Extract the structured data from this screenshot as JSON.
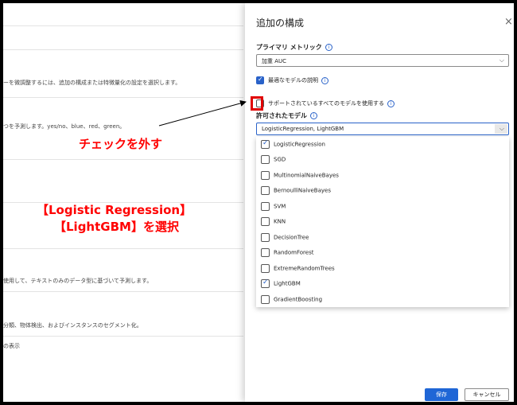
{
  "background": {
    "texts": [
      "ーを微調整するには、追加の構成または特徴量化の設定を選択します。",
      "つを予測します。yes/no、blue、red、green。",
      "使用して、テキストのみのデータ型に基づいて予測します。",
      "分類、物体検出、およびインスタンスのセグメント化。",
      "の表示"
    ]
  },
  "annotations": {
    "uncheck": "チェックを外す",
    "select_line1": "【Logistic Regression】",
    "select_line2": "【LightGBM】を選択"
  },
  "panel": {
    "title": "追加の構成",
    "close": "×",
    "primary_metric_label": "プライマリ メトリック",
    "primary_metric_value": "加重 AUC",
    "explain_best_model": "最適なモデルの説明",
    "explain_best_model_checked": true,
    "use_all_models": "サポートされているすべてのモデルを使用する",
    "use_all_models_checked": false,
    "allowed_models_label": "許可されたモデル",
    "allowed_models_value": "LogisticRegression, LightGBM",
    "models": [
      {
        "name": "LogisticRegression",
        "checked": true
      },
      {
        "name": "SGD",
        "checked": false
      },
      {
        "name": "MultinomialNaiveBayes",
        "checked": false
      },
      {
        "name": "BernoulliNaiveBayes",
        "checked": false
      },
      {
        "name": "SVM",
        "checked": false
      },
      {
        "name": "KNN",
        "checked": false
      },
      {
        "name": "DecisionTree",
        "checked": false
      },
      {
        "name": "RandomForest",
        "checked": false
      },
      {
        "name": "ExtremeRandomTrees",
        "checked": false
      },
      {
        "name": "LightGBM",
        "checked": true
      },
      {
        "name": "GradientBoosting",
        "checked": false
      }
    ],
    "save": "保存",
    "cancel": "キャンセル"
  },
  "colors": {
    "accent": "#2962c9",
    "annotation": "#ff0000"
  }
}
